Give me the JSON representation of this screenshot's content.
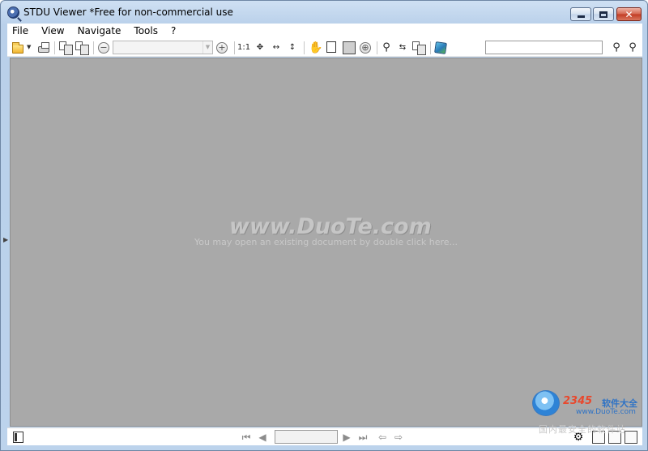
{
  "window": {
    "title": "STDU Viewer *Free for non-commercial use",
    "close_glyph": "✕"
  },
  "menu": {
    "items": [
      "File",
      "View",
      "Navigate",
      "Tools",
      "?"
    ]
  },
  "toolbar": {
    "zoom_value": "",
    "zoom_out_glyph": "−",
    "zoom_in_glyph": "+",
    "actual_size_label": "1:1",
    "search_value": "",
    "icons": [
      "open-folder-icon",
      "print-icon",
      "rotate-left-icon",
      "rotate-right-icon",
      "zoom-out-icon",
      "zoom-in-icon",
      "actual-size-icon",
      "fit-page-icon",
      "fit-width-icon",
      "fit-height-icon",
      "hand-tool-icon",
      "text-select-icon",
      "snapshot-icon",
      "zoom-tool-icon",
      "find-icon",
      "replace-icon",
      "copy-icon",
      "cube-icon",
      "find-previous-icon",
      "find-next-icon"
    ]
  },
  "viewport": {
    "watermark": "www.DuoTe.com",
    "hint": "You may open an existing document by double click here..."
  },
  "statusbar": {
    "page_value": "",
    "nav": {
      "first": "⏮",
      "prev": "◀",
      "next": "▶",
      "last": "⏭",
      "back": "⇦",
      "forward": "⇨"
    }
  },
  "branding": {
    "number": "2345",
    "name": "软件大全",
    "url": "www.DuoTe.com",
    "slogan": "国内最安全的软件站"
  },
  "colors": {
    "viewport_bg": "#a9a9a9",
    "titlebar_gradient_start": "#cfe0f3",
    "close_button": "#c13a22"
  }
}
